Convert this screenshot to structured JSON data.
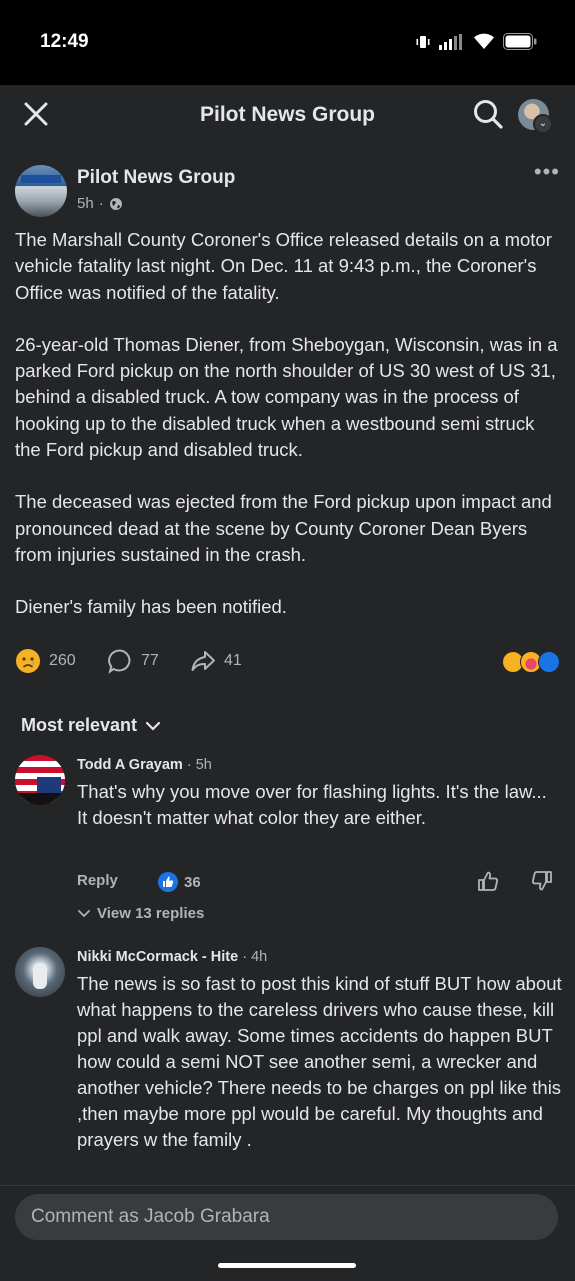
{
  "status_bar": {
    "time": "12:49"
  },
  "header": {
    "title": "Pilot News Group"
  },
  "post": {
    "page_name": "Pilot News Group",
    "time": "5h",
    "paragraphs": [
      "The Marshall County Coroner's Office released details on a motor vehicle fatality last night. On Dec. 11 at 9:43 p.m., the Coroner's Office was notified of the fatality.",
      "26-year-old Thomas Diener, from Sheboygan, Wisconsin, was in a parked Ford pickup on the north shoulder of US 30 west of US 31, behind a disabled truck. A tow company was in the process of hooking up to the disabled truck when a westbound semi struck the Ford pickup and disabled truck.",
      "The deceased was ejected from the Ford pickup upon impact and pronounced dead at the scene by County Coroner Dean Byers from injuries sustained in the crash.",
      "Diener's family has been notified."
    ],
    "reactions_count": "260",
    "comments_count": "77",
    "shares_count": "41",
    "reaction_icons": [
      "sad",
      "care",
      "like"
    ]
  },
  "comments_section": {
    "sort_label": "Most relevant",
    "comments": [
      {
        "author": "Todd A Grayam",
        "time": "5h",
        "lines": [
          "That's why you move over for flashing lights. It's the law...",
          "It doesn't matter what color they are either."
        ],
        "reply_label": "Reply",
        "likes": "36",
        "view_replies": "View 13 replies"
      },
      {
        "author": "Nikki McCormack - Hite",
        "time": "4h",
        "text": "The news is so fast to post this kind of stuff BUT how about what happens to the careless drivers who cause these, kill ppl and walk away.  Some times accidents do happen BUT how could a semi NOT see another semi, a wrecker and another  vehicle?  There needs to be  charges on ppl like this ,then maybe more ppl would be careful. My thoughts and prayers w the family ."
      }
    ]
  },
  "composer": {
    "placeholder": "Comment as Jacob Grabara"
  }
}
